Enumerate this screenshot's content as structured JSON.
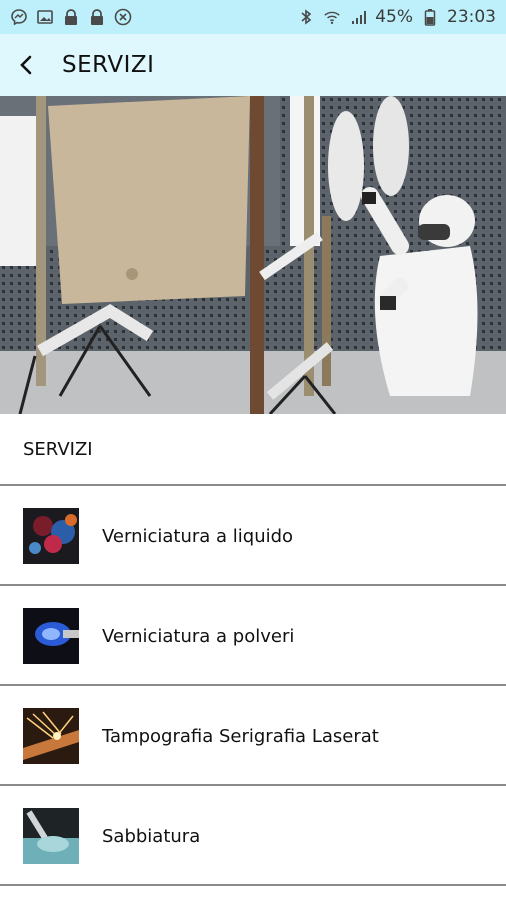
{
  "status_bar": {
    "battery_percent": "45%",
    "time": "23:03",
    "left_icons": [
      "messenger-icon",
      "image-icon",
      "lock-icon",
      "lock-icon",
      "close-circle-icon"
    ],
    "right_icons": [
      "bluetooth-icon",
      "wifi-icon",
      "signal-icon",
      "battery-icon"
    ]
  },
  "app_bar": {
    "title": "SERVIZI",
    "back_icon": "back-arrow-icon"
  },
  "hero": {
    "alt_icon": "hero-photo"
  },
  "section": {
    "title": "SERVIZI"
  },
  "services": [
    {
      "label": "Verniciatura a liquido"
    },
    {
      "label": "Verniciatura a polveri"
    },
    {
      "label": "Tampografia Serigrafia Laserat"
    },
    {
      "label": "Sabbiatura"
    }
  ],
  "colors": {
    "status_bar_bg": "#bdf0fb",
    "app_bar_bg": "#dff8fd",
    "divider": "#8a8a8a"
  }
}
